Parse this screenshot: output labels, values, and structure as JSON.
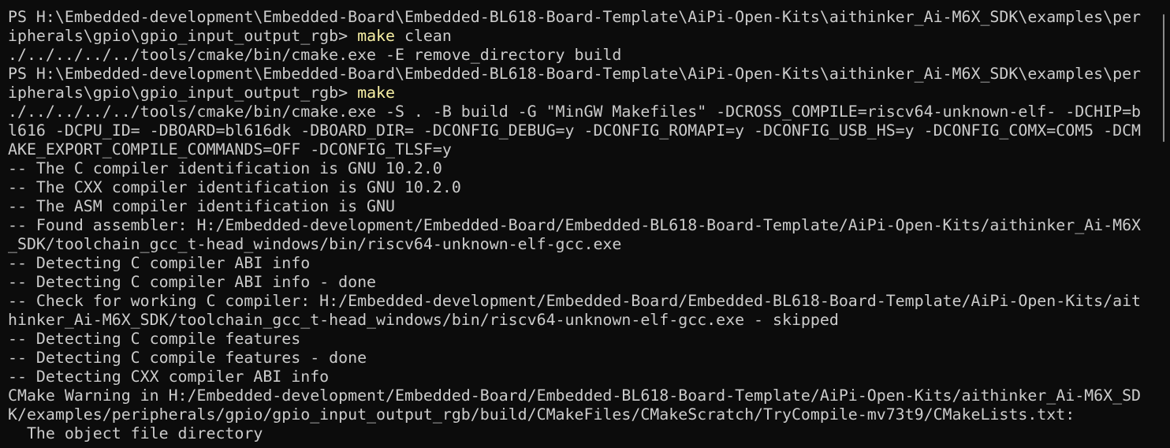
{
  "terminal": {
    "colors": {
      "background": "#0c0c0c",
      "foreground": "#cccccc",
      "command": "#f9f1a5"
    },
    "lines": [
      [
        {
          "text": "PS H:\\Embedded-development\\Embedded-Board\\Embedded-BL618-Board-Template\\AiPi-Open-Kits\\aithinker_Ai-M6X_SDK\\examples\\per"
        }
      ],
      [
        {
          "text": "ipherals\\gpio\\gpio_input_output_rgb> "
        },
        {
          "text": "make",
          "cmd": true
        },
        {
          "text": " clean"
        }
      ],
      [
        {
          "text": "./../../../../tools/cmake/bin/cmake.exe -E remove_directory build"
        }
      ],
      [
        {
          "text": "PS H:\\Embedded-development\\Embedded-Board\\Embedded-BL618-Board-Template\\AiPi-Open-Kits\\aithinker_Ai-M6X_SDK\\examples\\per"
        }
      ],
      [
        {
          "text": "ipherals\\gpio\\gpio_input_output_rgb> "
        },
        {
          "text": "make",
          "cmd": true
        }
      ],
      [
        {
          "text": "./../../../../tools/cmake/bin/cmake.exe -S . -B build -G \"MinGW Makefiles\" -DCROSS_COMPILE=riscv64-unknown-elf- -DCHIP=b"
        }
      ],
      [
        {
          "text": "l616 -DCPU_ID= -DBOARD=bl616dk -DBOARD_DIR= -DCONFIG_DEBUG=y -DCONFIG_ROMAPI=y -DCONFIG_USB_HS=y -DCONFIG_COMX=COM5 -DCM"
        }
      ],
      [
        {
          "text": "AKE_EXPORT_COMPILE_COMMANDS=OFF -DCONFIG_TLSF=y"
        }
      ],
      [
        {
          "text": "-- The C compiler identification is GNU 10.2.0"
        }
      ],
      [
        {
          "text": "-- The CXX compiler identification is GNU 10.2.0"
        }
      ],
      [
        {
          "text": "-- The ASM compiler identification is GNU"
        }
      ],
      [
        {
          "text": "-- Found assembler: H:/Embedded-development/Embedded-Board/Embedded-BL618-Board-Template/AiPi-Open-Kits/aithinker_Ai-M6X"
        }
      ],
      [
        {
          "text": "_SDK/toolchain_gcc_t-head_windows/bin/riscv64-unknown-elf-gcc.exe"
        }
      ],
      [
        {
          "text": "-- Detecting C compiler ABI info"
        }
      ],
      [
        {
          "text": "-- Detecting C compiler ABI info - done"
        }
      ],
      [
        {
          "text": "-- Check for working C compiler: H:/Embedded-development/Embedded-Board/Embedded-BL618-Board-Template/AiPi-Open-Kits/ait"
        }
      ],
      [
        {
          "text": "hinker_Ai-M6X_SDK/toolchain_gcc_t-head_windows/bin/riscv64-unknown-elf-gcc.exe - skipped"
        }
      ],
      [
        {
          "text": "-- Detecting C compile features"
        }
      ],
      [
        {
          "text": "-- Detecting C compile features - done"
        }
      ],
      [
        {
          "text": "-- Detecting CXX compiler ABI info"
        }
      ],
      [
        {
          "text": "CMake Warning in H:/Embedded-development/Embedded-Board/Embedded-BL618-Board-Template/AiPi-Open-Kits/aithinker_Ai-M6X_SD"
        }
      ],
      [
        {
          "text": "K/examples/peripherals/gpio/gpio_input_output_rgb/build/CMakeFiles/CMakeScratch/TryCompile-mv73t9/CMakeLists.txt:"
        }
      ],
      [
        {
          "text": "  The object file directory"
        }
      ]
    ]
  }
}
